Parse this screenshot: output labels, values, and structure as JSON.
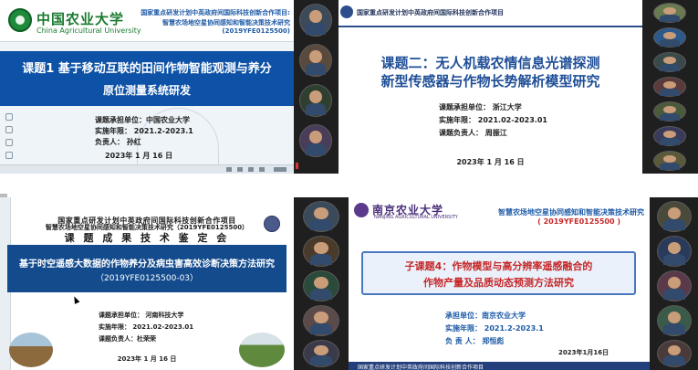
{
  "panel1": {
    "logo_cn": "中国农业大学",
    "logo_en": "China Agricultural University",
    "project_line1": "国家重点研发计划中英政府间国际科技创新合作项目:",
    "project_line2": "智慧农场地空星协同感知和智能决策技术研究(2019YFE0125500)",
    "title_line1": "课题1  基于移动互联的田间作物智能观测与养分",
    "title_line2": "原位测量系统研发",
    "undertaker": "课题承担单位：中国农业大学",
    "period": "实施年限：  2021.2-2023.1",
    "leader": "负责人：  孙红",
    "date": "2023年 1 月 16 日"
  },
  "panel2": {
    "header": "国家重点研发计划中英政府间国际科技创新合作项目",
    "title_line1": "课题二：无人机载农情信息光谱探测",
    "title_line2": "新型传感器与作物长势解析模型研究",
    "undertaker": "课题承担单位：  浙江大学",
    "period": "实施年限：  2021.02-2023.01",
    "leader": "课题负责人：  周振江",
    "date": "2023年 1 月 16 日"
  },
  "panel3": {
    "header_line1": "国家重点研发计划中英政府间国际科技创新合作项目",
    "header_line2": "智慧农场地空星协同感知和智能决策技术研究（2019YFE0125500）",
    "meeting": "课 题 成 果 技 术 鉴 定 会",
    "title_line1": "基于时空遥感大数据的作物养分及病虫害高效诊断决策方法研究",
    "title_line2": "（2019YFE0125500-03）",
    "undertaker": "课题承担单位：  河南科技大学",
    "period": "实施年限：  2021.02-2023.01",
    "leader": "课题负责人：杜荣荣",
    "date": "2023年 1 月 16 日"
  },
  "panel4": {
    "logo_cn": "南京农业大学",
    "logo_en": "NANJING AGRICULTURAL UNIVERSITY",
    "header_line1": "智慧农场地空星协同感知和智能决策技术研究",
    "header_line2": "( 2019YFE0125500 )",
    "title_line1": "子课题4：作物模型与高分辨率遥感融合的",
    "title_line2": "作物产量及品质动态预测方法研究",
    "undertaker": "承担单位：南京农业大学",
    "period": "实施年限：  2021.2-2023.1",
    "leader": "负  责  人：  郑恒彪",
    "date": "2023年1月16日",
    "footer": "国家重点研发计划中英政府间国际科技创新合作项目"
  },
  "colors": {
    "banner_blue": "#0d52a6",
    "title_blue": "#1f4e97",
    "accent_red": "#c62828",
    "cau_green": "#1a7a30",
    "nau_purple": "#4a2e7a",
    "strip_dark": "#1f1f1f"
  },
  "icons": {
    "participant": "person-avatar-icon",
    "mute": "microphone-muted-icon"
  }
}
